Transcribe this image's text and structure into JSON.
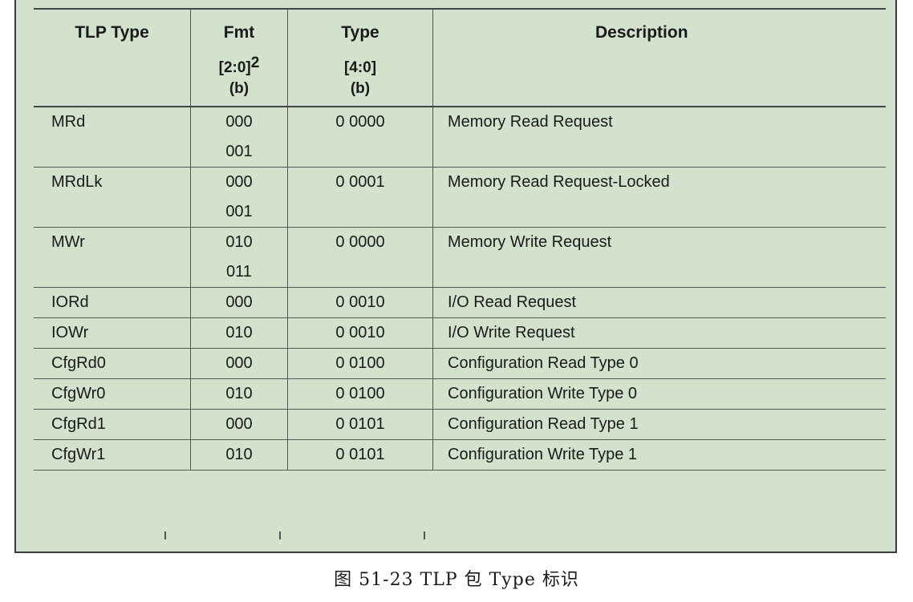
{
  "table": {
    "headers": {
      "tlp_type": "TLP Type",
      "fmt": "Fmt",
      "fmt_bits": "[2:0]",
      "fmt_sup": "2",
      "fmt_unit": "(b)",
      "type": "Type",
      "type_bits": "[4:0]",
      "type_unit": "(b)",
      "description": "Description"
    },
    "rows": [
      {
        "type": "MRd",
        "fmt": [
          "000",
          "001"
        ],
        "typebits": "0 0000",
        "desc": "Memory Read Request"
      },
      {
        "type": "MRdLk",
        "fmt": [
          "000",
          "001"
        ],
        "typebits": "0 0001",
        "desc": "Memory Read Request-Locked"
      },
      {
        "type": "MWr",
        "fmt": [
          "010",
          "011"
        ],
        "typebits": "0 0000",
        "desc": "Memory Write Request"
      },
      {
        "type": "IORd",
        "fmt": [
          "000"
        ],
        "typebits": "0 0010",
        "desc": "I/O Read Request"
      },
      {
        "type": "IOWr",
        "fmt": [
          "010"
        ],
        "typebits": "0 0010",
        "desc": "I/O Write Request"
      },
      {
        "type": "CfgRd0",
        "fmt": [
          "000"
        ],
        "typebits": "0 0100",
        "desc": "Configuration Read Type 0"
      },
      {
        "type": "CfgWr0",
        "fmt": [
          "010"
        ],
        "typebits": "0 0100",
        "desc": "Configuration Write Type 0"
      },
      {
        "type": "CfgRd1",
        "fmt": [
          "000"
        ],
        "typebits": "0 0101",
        "desc": "Configuration Read Type 1"
      },
      {
        "type": "CfgWr1",
        "fmt": [
          "010"
        ],
        "typebits": "0 0101",
        "desc": "Configuration Write Type 1"
      }
    ]
  },
  "caption": "图 51-23  TLP 包 Type 标识",
  "colors": {
    "panel_background": "#d3e2cc",
    "rule": "#555555",
    "text": "#1a1a1a"
  }
}
